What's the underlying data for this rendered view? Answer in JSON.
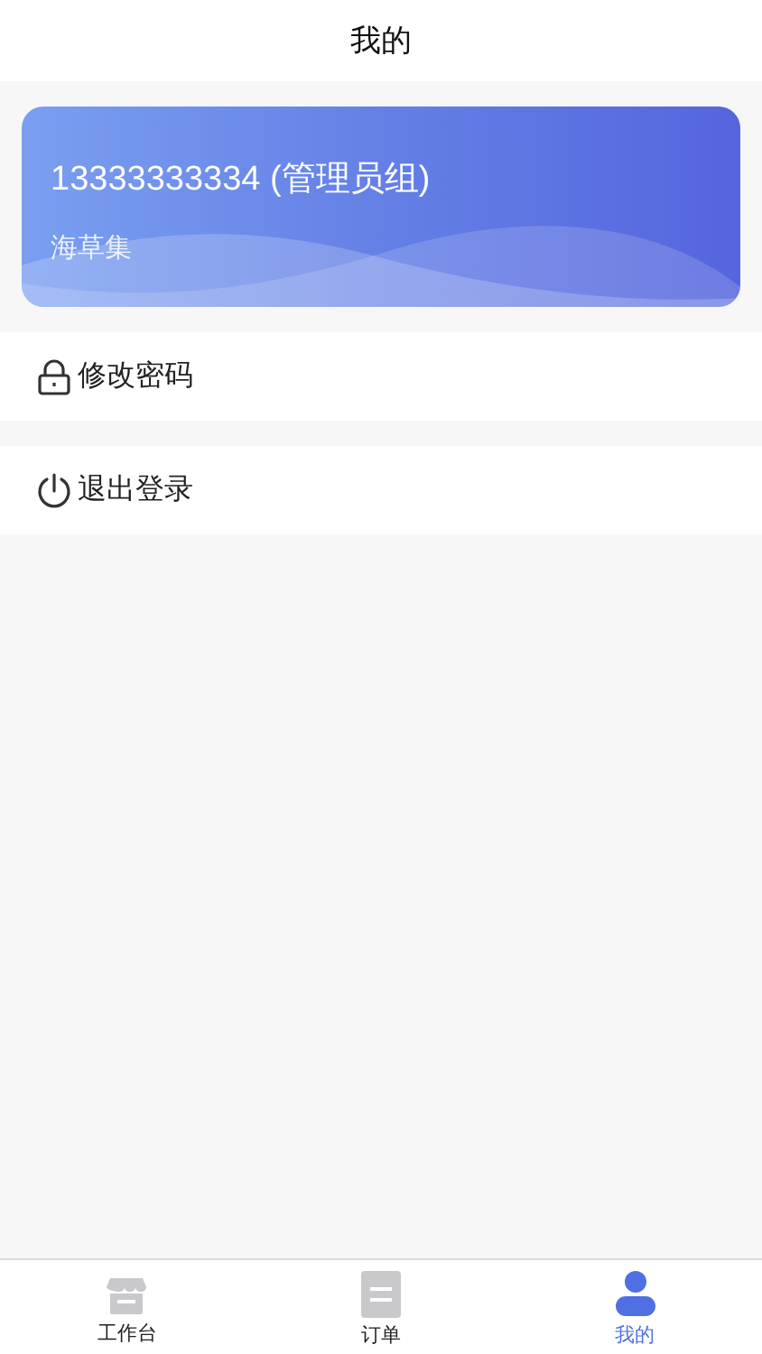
{
  "header": {
    "title": "我的"
  },
  "profile": {
    "account": "13333333334 (管理员组)",
    "store": "海草集"
  },
  "menu": [
    {
      "kind": "lock",
      "label": "修改密码"
    },
    {
      "kind": "power",
      "label": "退出登录"
    }
  ],
  "tabs": [
    {
      "kind": "store",
      "label": "工作台",
      "selected": false
    },
    {
      "kind": "document",
      "label": "订单",
      "selected": false
    },
    {
      "kind": "person",
      "label": "我的",
      "selected": true
    }
  ]
}
